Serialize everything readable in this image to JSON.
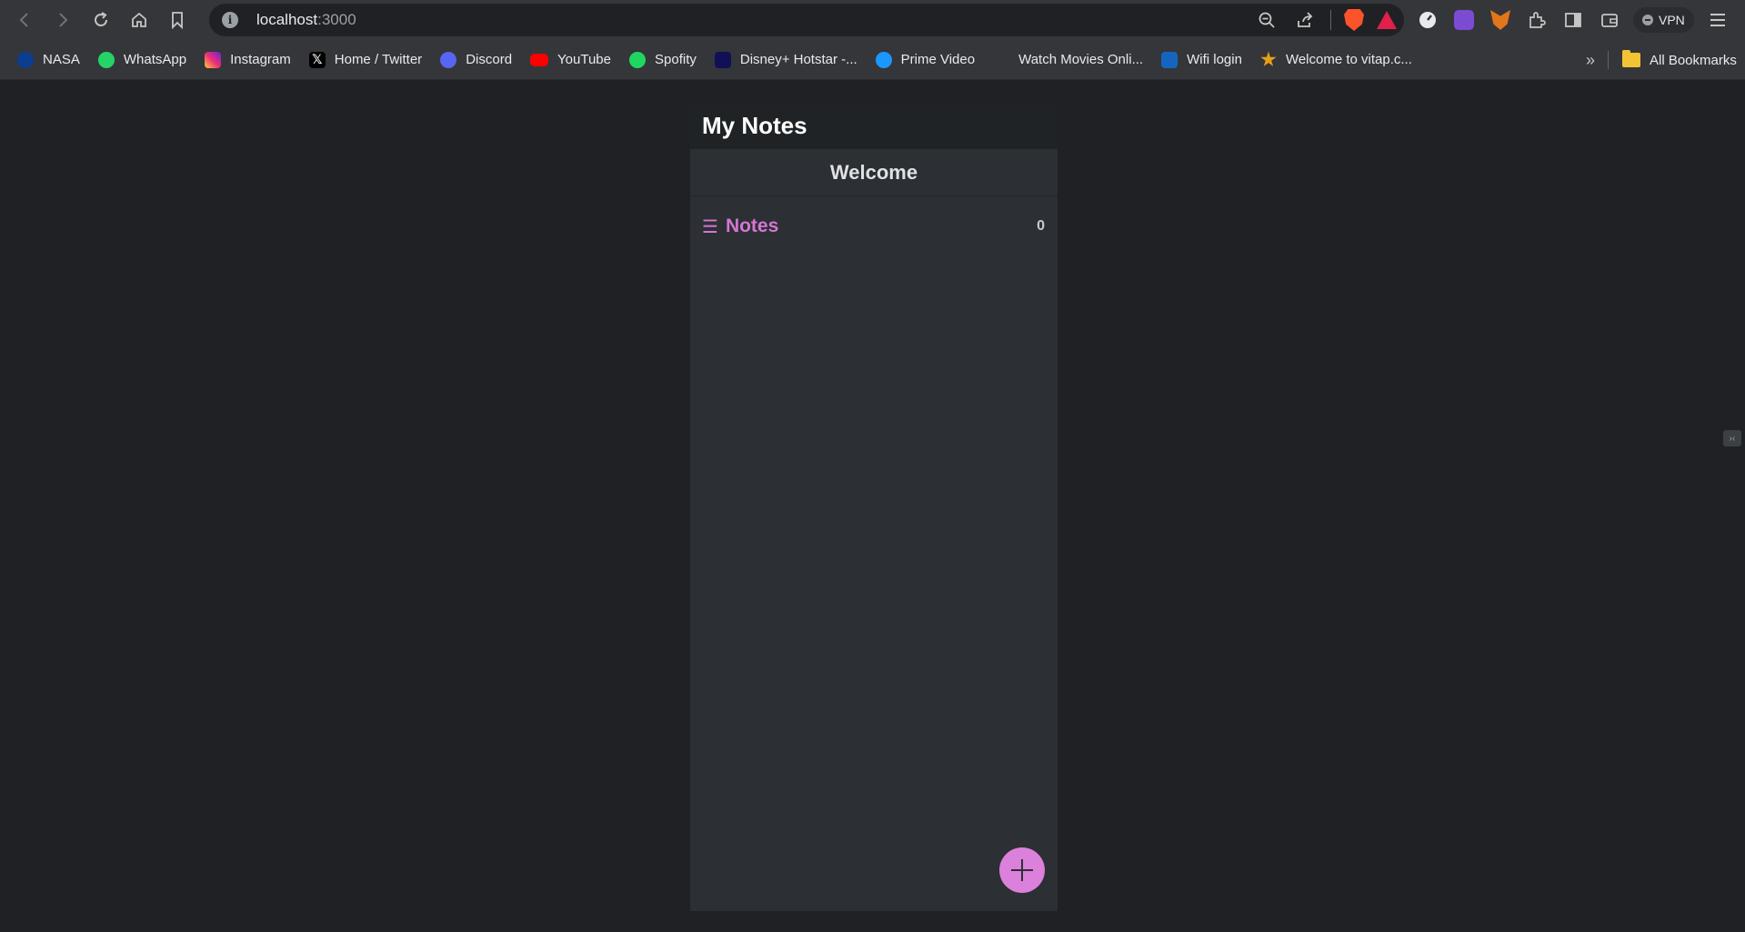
{
  "browser": {
    "url_host": "localhost",
    "url_port": ":3000",
    "vpn_label": "VPN",
    "all_bookmarks_label": "All Bookmarks",
    "more_bookmarks_glyph": "»",
    "bookmarks": [
      {
        "label": "NASA",
        "icon": "nasa-icon"
      },
      {
        "label": "WhatsApp",
        "icon": "whatsapp-icon"
      },
      {
        "label": "Instagram",
        "icon": "instagram-icon"
      },
      {
        "label": "Home / Twitter",
        "icon": "x-twitter-icon"
      },
      {
        "label": "Discord",
        "icon": "discord-icon"
      },
      {
        "label": "YouTube",
        "icon": "youtube-icon"
      },
      {
        "label": "Spofity",
        "icon": "spotify-icon"
      },
      {
        "label": "Disney+ Hotstar -...",
        "icon": "hotstar-icon"
      },
      {
        "label": "Prime Video",
        "icon": "prime-video-icon"
      },
      {
        "label": "Watch Movies Onli...",
        "icon": "aha-icon"
      },
      {
        "label": "Wifi login",
        "icon": "wifi-login-icon"
      },
      {
        "label": "Welcome to vitap.c...",
        "icon": "vitap-icon"
      }
    ]
  },
  "app": {
    "title": "My Notes",
    "welcome": "Welcome",
    "notes_label": "Notes",
    "notes_icon_glyph": "☰",
    "notes_count": "0",
    "accent_color": "#d476d4",
    "fab_color": "#db80db"
  }
}
